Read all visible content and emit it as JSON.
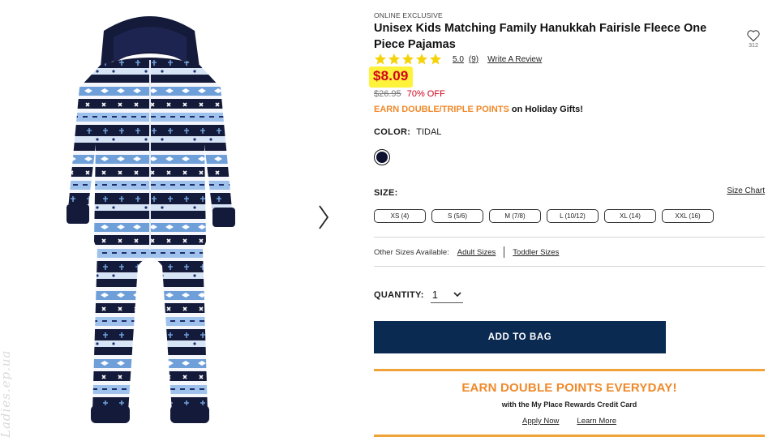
{
  "watermark": "Ladies.ep.ua",
  "product": {
    "badge": "ONLINE EXCLUSIVE",
    "title": "Unisex Kids Matching Family Hanukkah Fairisle Fleece One Piece Pajamas",
    "wishlist_count": "312",
    "rating_value": "5.0",
    "review_count": "(9)",
    "write_review": "Write A Review",
    "stars": 5,
    "price": "$8.09",
    "original_price": "$26.95",
    "discount": "70% OFF",
    "earn_highlight": "EARN DOUBLE/TRIPLE POINTS",
    "earn_rest": " on Holiday Gifts!",
    "color_label": "COLOR:",
    "color_value": "TIDAL",
    "size_label": "SIZE:",
    "size_chart": "Size Chart",
    "sizes": [
      "XS (4)",
      "S (5/6)",
      "M (7/8)",
      "L (10/12)",
      "XL (14)",
      "XXL (16)"
    ],
    "other_sizes_label": "Other Sizes Available:",
    "adult_sizes": "Adult Sizes",
    "toddler_sizes": "Toddler Sizes",
    "quantity_label": "QUANTITY:",
    "quantity_value": "1",
    "add_to_bag": "ADD TO BAG"
  },
  "promo": {
    "title": "EARN DOUBLE POINTS EVERYDAY!",
    "subtitle": "with the My Place Rewards Credit Card",
    "apply_now": "Apply Now",
    "learn_more": "Learn More"
  },
  "colors": {
    "price_red": "#d0021b",
    "highlight_yellow": "#fff23a",
    "promo_orange": "#f0892a",
    "navy": "#0a2a52",
    "swatch_tidal": "#0d1130"
  }
}
